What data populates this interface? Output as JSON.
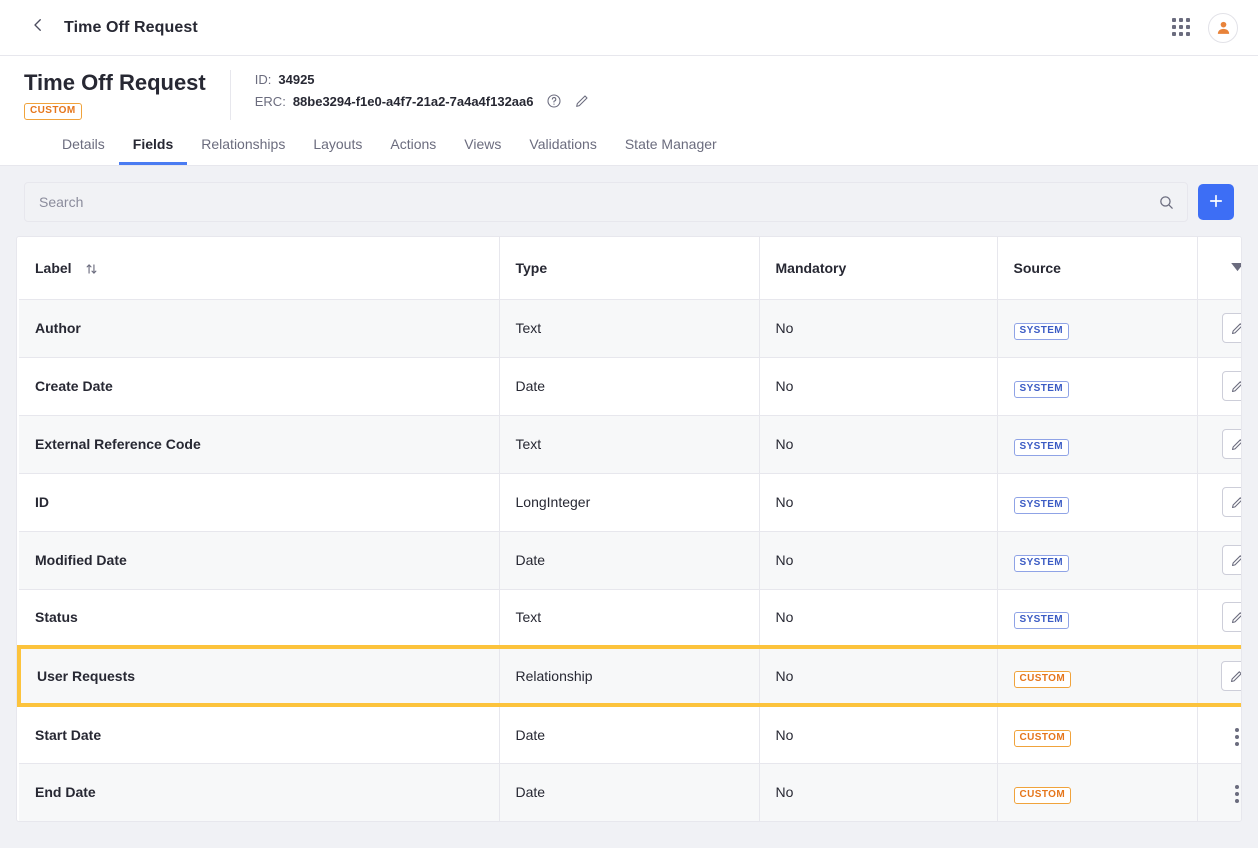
{
  "appbar": {
    "back_icon": "chevron-left-icon",
    "title": "Time Off Request",
    "apps_icon": "grid-apps-icon",
    "avatar_icon": "user-avatar-icon"
  },
  "page_header": {
    "title": "Time Off Request",
    "badge": "CUSTOM",
    "id_label": "ID:",
    "id_value": "34925",
    "erc_label": "ERC:",
    "erc_value": "88be3294-f1e0-a4f7-21a2-7a4a4f132aa6",
    "help_icon": "question-circle-icon",
    "edit_icon": "pencil-icon"
  },
  "tabs": [
    {
      "label": "Details",
      "active": false
    },
    {
      "label": "Fields",
      "active": true
    },
    {
      "label": "Relationships",
      "active": false
    },
    {
      "label": "Layouts",
      "active": false
    },
    {
      "label": "Actions",
      "active": false
    },
    {
      "label": "Views",
      "active": false
    },
    {
      "label": "Validations",
      "active": false
    },
    {
      "label": "State Manager",
      "active": false
    }
  ],
  "search": {
    "placeholder": "Search",
    "value": "",
    "search_icon": "search-icon",
    "add_label": "+",
    "add_icon": "plus-icon"
  },
  "table": {
    "columns": [
      "Label",
      "Type",
      "Mandatory",
      "Source",
      ""
    ],
    "sort_icon": "sort-arrows-icon",
    "filter_icon": "caret-down-icon",
    "rows": [
      {
        "label": "Author",
        "type": "Text",
        "mandatory": "No",
        "source": "SYSTEM",
        "action": "edit",
        "highlighted": false
      },
      {
        "label": "Create Date",
        "type": "Date",
        "mandatory": "No",
        "source": "SYSTEM",
        "action": "edit",
        "highlighted": false
      },
      {
        "label": "External Reference Code",
        "type": "Text",
        "mandatory": "No",
        "source": "SYSTEM",
        "action": "edit",
        "highlighted": false
      },
      {
        "label": "ID",
        "type": "LongInteger",
        "mandatory": "No",
        "source": "SYSTEM",
        "action": "edit",
        "highlighted": false
      },
      {
        "label": "Modified Date",
        "type": "Date",
        "mandatory": "No",
        "source": "SYSTEM",
        "action": "edit",
        "highlighted": false
      },
      {
        "label": "Status",
        "type": "Text",
        "mandatory": "No",
        "source": "SYSTEM",
        "action": "edit",
        "highlighted": false
      },
      {
        "label": "User Requests",
        "type": "Relationship",
        "mandatory": "No",
        "source": "CUSTOM",
        "action": "edit",
        "highlighted": true
      },
      {
        "label": "Start Date",
        "type": "Date",
        "mandatory": "No",
        "source": "CUSTOM",
        "action": "kebab",
        "highlighted": false
      },
      {
        "label": "End Date",
        "type": "Date",
        "mandatory": "No",
        "source": "CUSTOM",
        "action": "kebab",
        "highlighted": false
      }
    ]
  },
  "colors": {
    "accent_blue": "#3d6ef5",
    "tab_underline": "#4a7cf2",
    "highlight_amber": "#fcc33c",
    "badge_custom": "#e5761c",
    "badge_system": "#3b5bc4",
    "avatar_orange": "#e8833a"
  }
}
